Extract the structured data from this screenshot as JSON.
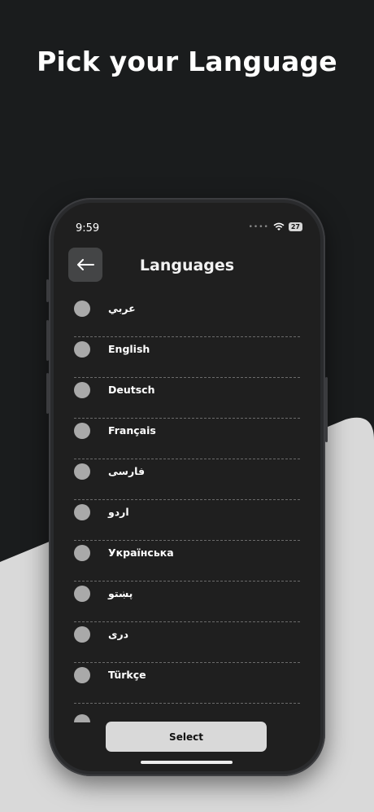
{
  "headline": "Pick your Language",
  "status": {
    "time": "9:59",
    "battery": "27"
  },
  "header": {
    "title": "Languages"
  },
  "languages": [
    {
      "label": "عربي"
    },
    {
      "label": "English"
    },
    {
      "label": "Deutsch"
    },
    {
      "label": "Français"
    },
    {
      "label": "فارسی"
    },
    {
      "label": "اردو"
    },
    {
      "label": "Українська"
    },
    {
      "label": "پښتو"
    },
    {
      "label": "دری"
    },
    {
      "label": "Türkçe"
    }
  ],
  "actions": {
    "select_label": "Select"
  },
  "colors": {
    "background": "#1a1c1d",
    "accent_shape": "#d9d9d9",
    "screen": "#1f1f1f",
    "radio": "#a9a9a9"
  }
}
